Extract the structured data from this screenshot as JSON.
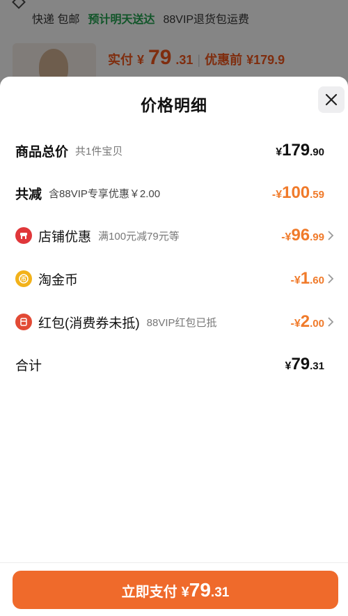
{
  "background": {
    "delivery": {
      "shipping": "快递 包邮",
      "arrival": "预计明天送达",
      "return": "88VIP退货包运费"
    },
    "price_line": {
      "paid_label": "实付",
      "paid_currency": "¥",
      "paid_int": "79",
      "paid_dec": ".31",
      "before_label": "优惠前",
      "before_price": "¥179.9"
    }
  },
  "sheet": {
    "title": "价格明细",
    "close_icon": "close-icon",
    "rows": [
      {
        "label": "商品总价",
        "sub": "共1件宝贝",
        "currency": "¥",
        "int": "179",
        "dec": ".90",
        "color": "#111111"
      },
      {
        "label": "共减",
        "sub": "含88VIP专享优惠￥2.00",
        "currency": "-¥",
        "int": "100",
        "dec": ".59",
        "color": "#f07a2a"
      },
      {
        "label": "店铺优惠",
        "sub": "满100元减79元等",
        "currency": "-¥",
        "int": "96",
        "dec": ".99",
        "icon": "shop-icon",
        "color": "#f07a2a"
      },
      {
        "label": "淘金币",
        "sub": "",
        "currency": "-¥",
        "int": "1",
        "dec": ".60",
        "icon": "coin-icon",
        "color": "#f07a2a"
      },
      {
        "label": "红包(消费券未抵)",
        "sub": "88VIP红包已抵",
        "currency": "-¥",
        "int": "2",
        "dec": ".00",
        "icon": "red-packet-icon",
        "color": "#f07a2a"
      },
      {
        "label": "合计",
        "sub": "",
        "currency": "¥",
        "int": "79",
        "dec": ".31",
        "color": "#111111"
      }
    ]
  },
  "pay_button": {
    "label": "立即支付",
    "currency": "¥",
    "int": "79",
    "dec": ".31",
    "color": "#ef6a2b"
  },
  "colors": {
    "accent": "#ef6a2b",
    "discount": "#f07a2a",
    "shop_icon": "#e0373a",
    "coin_icon": "#f2b21a",
    "red_packet_icon": "#e24a35"
  }
}
